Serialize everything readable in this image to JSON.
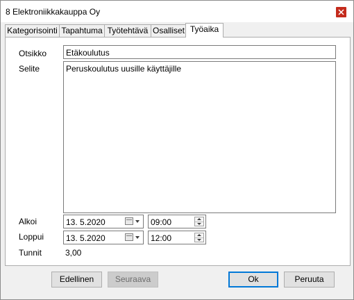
{
  "window": {
    "title": "8 Elektroniikkakauppa Oy"
  },
  "tabs": [
    {
      "label": "Kategorisointi"
    },
    {
      "label": "Tapahtuma"
    },
    {
      "label": "Työtehtävä"
    },
    {
      "label": "Osalliset"
    },
    {
      "label": "Työaika"
    }
  ],
  "form": {
    "otsikko_label": "Otsikko",
    "otsikko_value": "Etäkoulutus",
    "selite_label": "Selite",
    "selite_value": "Peruskoulutus uusille käyttäjille",
    "alkoi_label": "Alkoi",
    "alkoi_date": "13.  5.2020",
    "alkoi_time": "09:00",
    "loppui_label": "Loppui",
    "loppui_date": "13.  5.2020",
    "loppui_time": "12:00",
    "tunnit_label": "Tunnit",
    "tunnit_value": "3,00"
  },
  "buttons": {
    "previous": "Edellinen",
    "next": "Seuraava",
    "ok": "Ok",
    "cancel": "Peruuta"
  }
}
